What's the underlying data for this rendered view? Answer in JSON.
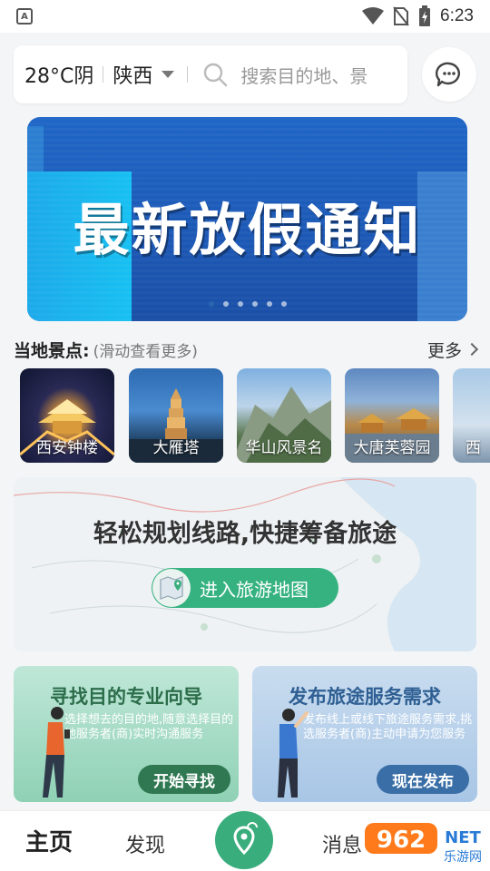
{
  "status_bar": {
    "time": "6:23",
    "app_badge": "A"
  },
  "header": {
    "weather": "28°C阴",
    "province": "陕西",
    "search_placeholder": "搜索目的地、景"
  },
  "banner": {
    "title": "最新放假通知",
    "dot_count": 6,
    "active_dot": 0
  },
  "local_spots": {
    "title": "当地景点:",
    "subtitle": "(滑动查看更多)",
    "more_label": "更多",
    "items": [
      {
        "label": "西安钟楼"
      },
      {
        "label": "大雁塔"
      },
      {
        "label": "华山风景名"
      },
      {
        "label": "大唐芙蓉园"
      },
      {
        "label": "西"
      }
    ]
  },
  "map_card": {
    "title": "轻松规划线路,快捷筹备旅途",
    "button_label": "进入旅游地图"
  },
  "cards": {
    "guide": {
      "title": "寻找目的专业向导",
      "desc": "选择想去的目的地,随意选择目的地服务者(商)实时沟通服务",
      "button": "开始寻找"
    },
    "publish": {
      "title": "发布旅途服务需求",
      "desc": "发布线上或线下旅途服务需求,挑选服务者(商)主动申请为您服务",
      "button": "现在发布"
    }
  },
  "bottom_nav": {
    "home": "主页",
    "discover": "发现",
    "messages": "消息"
  },
  "watermark": {
    "text": "962",
    "suffix": "NET",
    "sub": "乐游网"
  },
  "colors": {
    "primary_green": "#3aad7c",
    "banner_blue": "#1f66c6",
    "guide_button": "#2f7852",
    "publish_button": "#3a6ea6"
  }
}
